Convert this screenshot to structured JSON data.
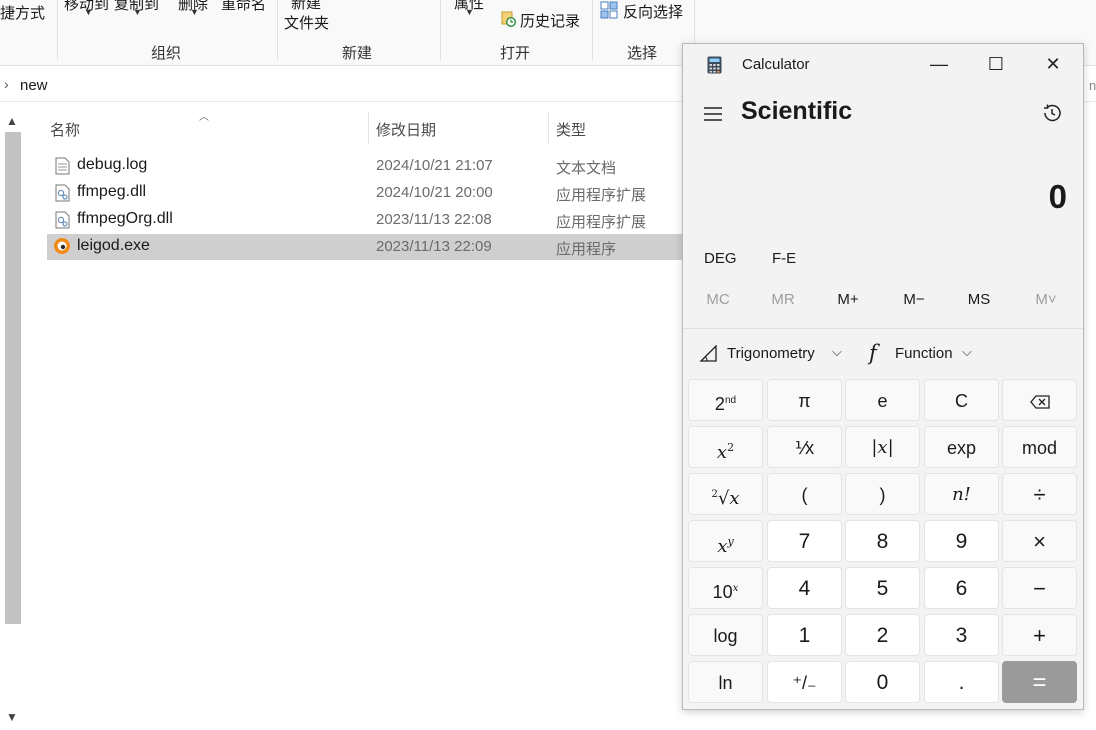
{
  "ribbon": {
    "shortcut_partial": "捷方式",
    "move_to": "移动到",
    "copy_to": "复制到",
    "delete": "删除",
    "rename": "重命名",
    "new_item": "新建",
    "new_folder": "文件夹",
    "properties": "属性",
    "history": "历史记录",
    "invert_selection": "反向选择",
    "groups": {
      "organize": "组织",
      "new": "新建",
      "open": "打开",
      "select": "选择"
    }
  },
  "address": {
    "path": "new",
    "right_partial": "n"
  },
  "columns": {
    "name": "名称",
    "date": "修改日期",
    "type": "类型"
  },
  "files": [
    {
      "name": "debug.log",
      "date": "2024/10/21 21:07",
      "type": "文本文档",
      "icon": "text-file-icon",
      "selected": false
    },
    {
      "name": "ffmpeg.dll",
      "date": "2024/10/21 20:00",
      "type": "应用程序扩展",
      "icon": "dll-file-icon",
      "selected": false
    },
    {
      "name": "ffmpegOrg.dll",
      "date": "2023/11/13 22:08",
      "type": "应用程序扩展",
      "icon": "dll-file-icon",
      "selected": false
    },
    {
      "name": "leigod.exe",
      "date": "2023/11/13 22:09",
      "type": "应用程序",
      "icon": "app-exe-icon",
      "selected": true
    }
  ],
  "calculator": {
    "title": "Calculator",
    "mode": "Scientific",
    "display": "0",
    "angle_unit": "DEG",
    "fe": "F-E",
    "memory": [
      "MC",
      "MR",
      "M+",
      "M−",
      "MS",
      "M˅"
    ],
    "trigonometry": "Trigonometry",
    "function": "Function",
    "function_glyph": "f",
    "keys": {
      "second": "2nd",
      "pi": "π",
      "e": "e",
      "clear": "C",
      "backspace": "⌫",
      "square": "x2",
      "reciprocal": "⅟x",
      "abs": "|x|",
      "exp": "exp",
      "mod": "mod",
      "root": "2√x",
      "lparen": "(",
      "rparen": ")",
      "factorial": "n!",
      "divide": "÷",
      "power": "xy",
      "seven": "7",
      "eight": "8",
      "nine": "9",
      "multiply": "×",
      "ten_power": "10x",
      "four": "4",
      "five": "5",
      "six": "6",
      "minus": "−",
      "log": "log",
      "one": "1",
      "two": "2",
      "three": "3",
      "plus": "+",
      "ln": "ln",
      "negate": "⁺/₋",
      "zero": "0",
      "decimal": ".",
      "equals": "="
    }
  }
}
